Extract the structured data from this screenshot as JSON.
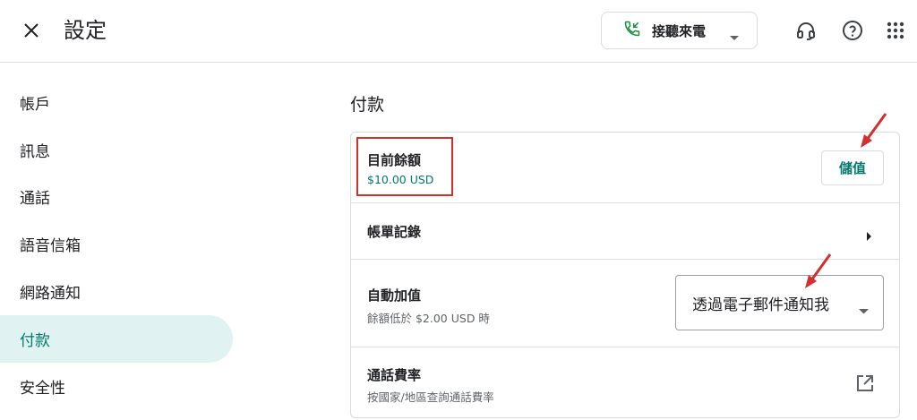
{
  "header": {
    "title": "設定",
    "call_status": {
      "label": "接聽來電"
    }
  },
  "sidebar": {
    "items": [
      {
        "label": "帳戶"
      },
      {
        "label": "訊息"
      },
      {
        "label": "通話"
      },
      {
        "label": "語音信箱"
      },
      {
        "label": "網路通知"
      },
      {
        "label": "付款",
        "active": true
      },
      {
        "label": "安全性"
      }
    ]
  },
  "main": {
    "section_title": "付款",
    "balance": {
      "title": "目前餘額",
      "value": "$10.00 USD",
      "topup_label": "儲值"
    },
    "billing": {
      "title": "帳單記錄"
    },
    "auto_recharge": {
      "title": "自動加值",
      "subtitle": "餘額低於 $2.00 USD 時",
      "selected": "透過電子郵件通知我"
    },
    "call_rates": {
      "title": "通話費率",
      "subtitle": "按國家/地區查詢通話費率"
    }
  },
  "colors": {
    "accent": "#00796b",
    "active_bg": "#e0f2f1",
    "annotation": "#d32f2f",
    "call_icon": "#1e8e3e"
  }
}
